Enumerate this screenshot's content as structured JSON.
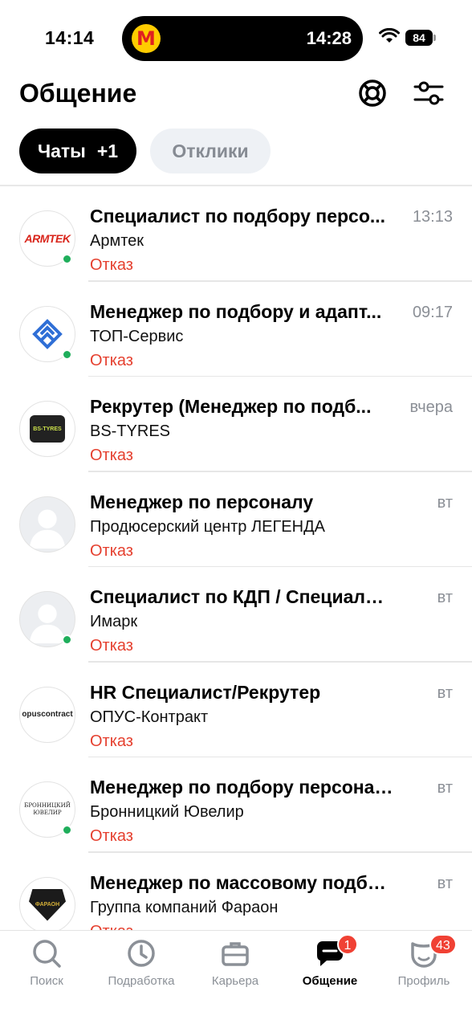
{
  "status_bar": {
    "time": "14:14",
    "island_time": "14:28",
    "battery": "84"
  },
  "header": {
    "title": "Общение"
  },
  "tabs": [
    {
      "label": "Чаты",
      "count": "+1"
    },
    {
      "label": "Отклики"
    }
  ],
  "chats": [
    {
      "title": "Специалист по подбору персо...",
      "company": "Армтек",
      "status": "Отказ",
      "time": "13:13",
      "online": true,
      "logo_text": "ARMTEK"
    },
    {
      "title": "Менеджер по подбору и адапт...",
      "company": "ТОП-Сервис",
      "status": "Отказ",
      "time": "09:17",
      "online": true
    },
    {
      "title": "Рекрутер (Менеджер по подб...",
      "company": "BS-TYRES",
      "status": "Отказ",
      "time": "вчера",
      "online": false,
      "logo_text": "BS-TYRES"
    },
    {
      "title": "Менеджер по персоналу",
      "company": "Продюсерский центр ЛЕГЕНДА",
      "status": "Отказ",
      "time": "вт",
      "online": false
    },
    {
      "title": "Специалист по КДП / Специалист...",
      "company": "Имарк",
      "status": "Отказ",
      "time": "вт",
      "online": true
    },
    {
      "title": "HR Специалист/Рекрутер",
      "company": "ОПУС-Контракт",
      "status": "Отказ",
      "time": "вт",
      "online": false,
      "logo_text": "opuscontract"
    },
    {
      "title": "Менеджер по подбору персонала",
      "company": "Бронницкий Ювелир",
      "status": "Отказ",
      "time": "вт",
      "online": true,
      "logo_text": "БРОННИЦКИЙ ЮВЕЛИР"
    },
    {
      "title": "Менеджер по массовому подбор...",
      "company": "Группа компаний Фараон",
      "status": "Отказ",
      "time": "вт",
      "online": false,
      "logo_text": "ФАРАОН"
    }
  ],
  "bottom_nav": [
    {
      "label": "Поиск",
      "icon": "search-icon"
    },
    {
      "label": "Подработка",
      "icon": "clock-icon"
    },
    {
      "label": "Карьера",
      "icon": "briefcase-icon"
    },
    {
      "label": "Общение",
      "icon": "chat-icon",
      "badge": "1",
      "active": true
    },
    {
      "label": "Профиль",
      "icon": "profile-icon",
      "badge": "43"
    }
  ],
  "colors": {
    "accent_red": "#e5402f",
    "online_green": "#1fae5b",
    "badge_red": "#f04134"
  }
}
